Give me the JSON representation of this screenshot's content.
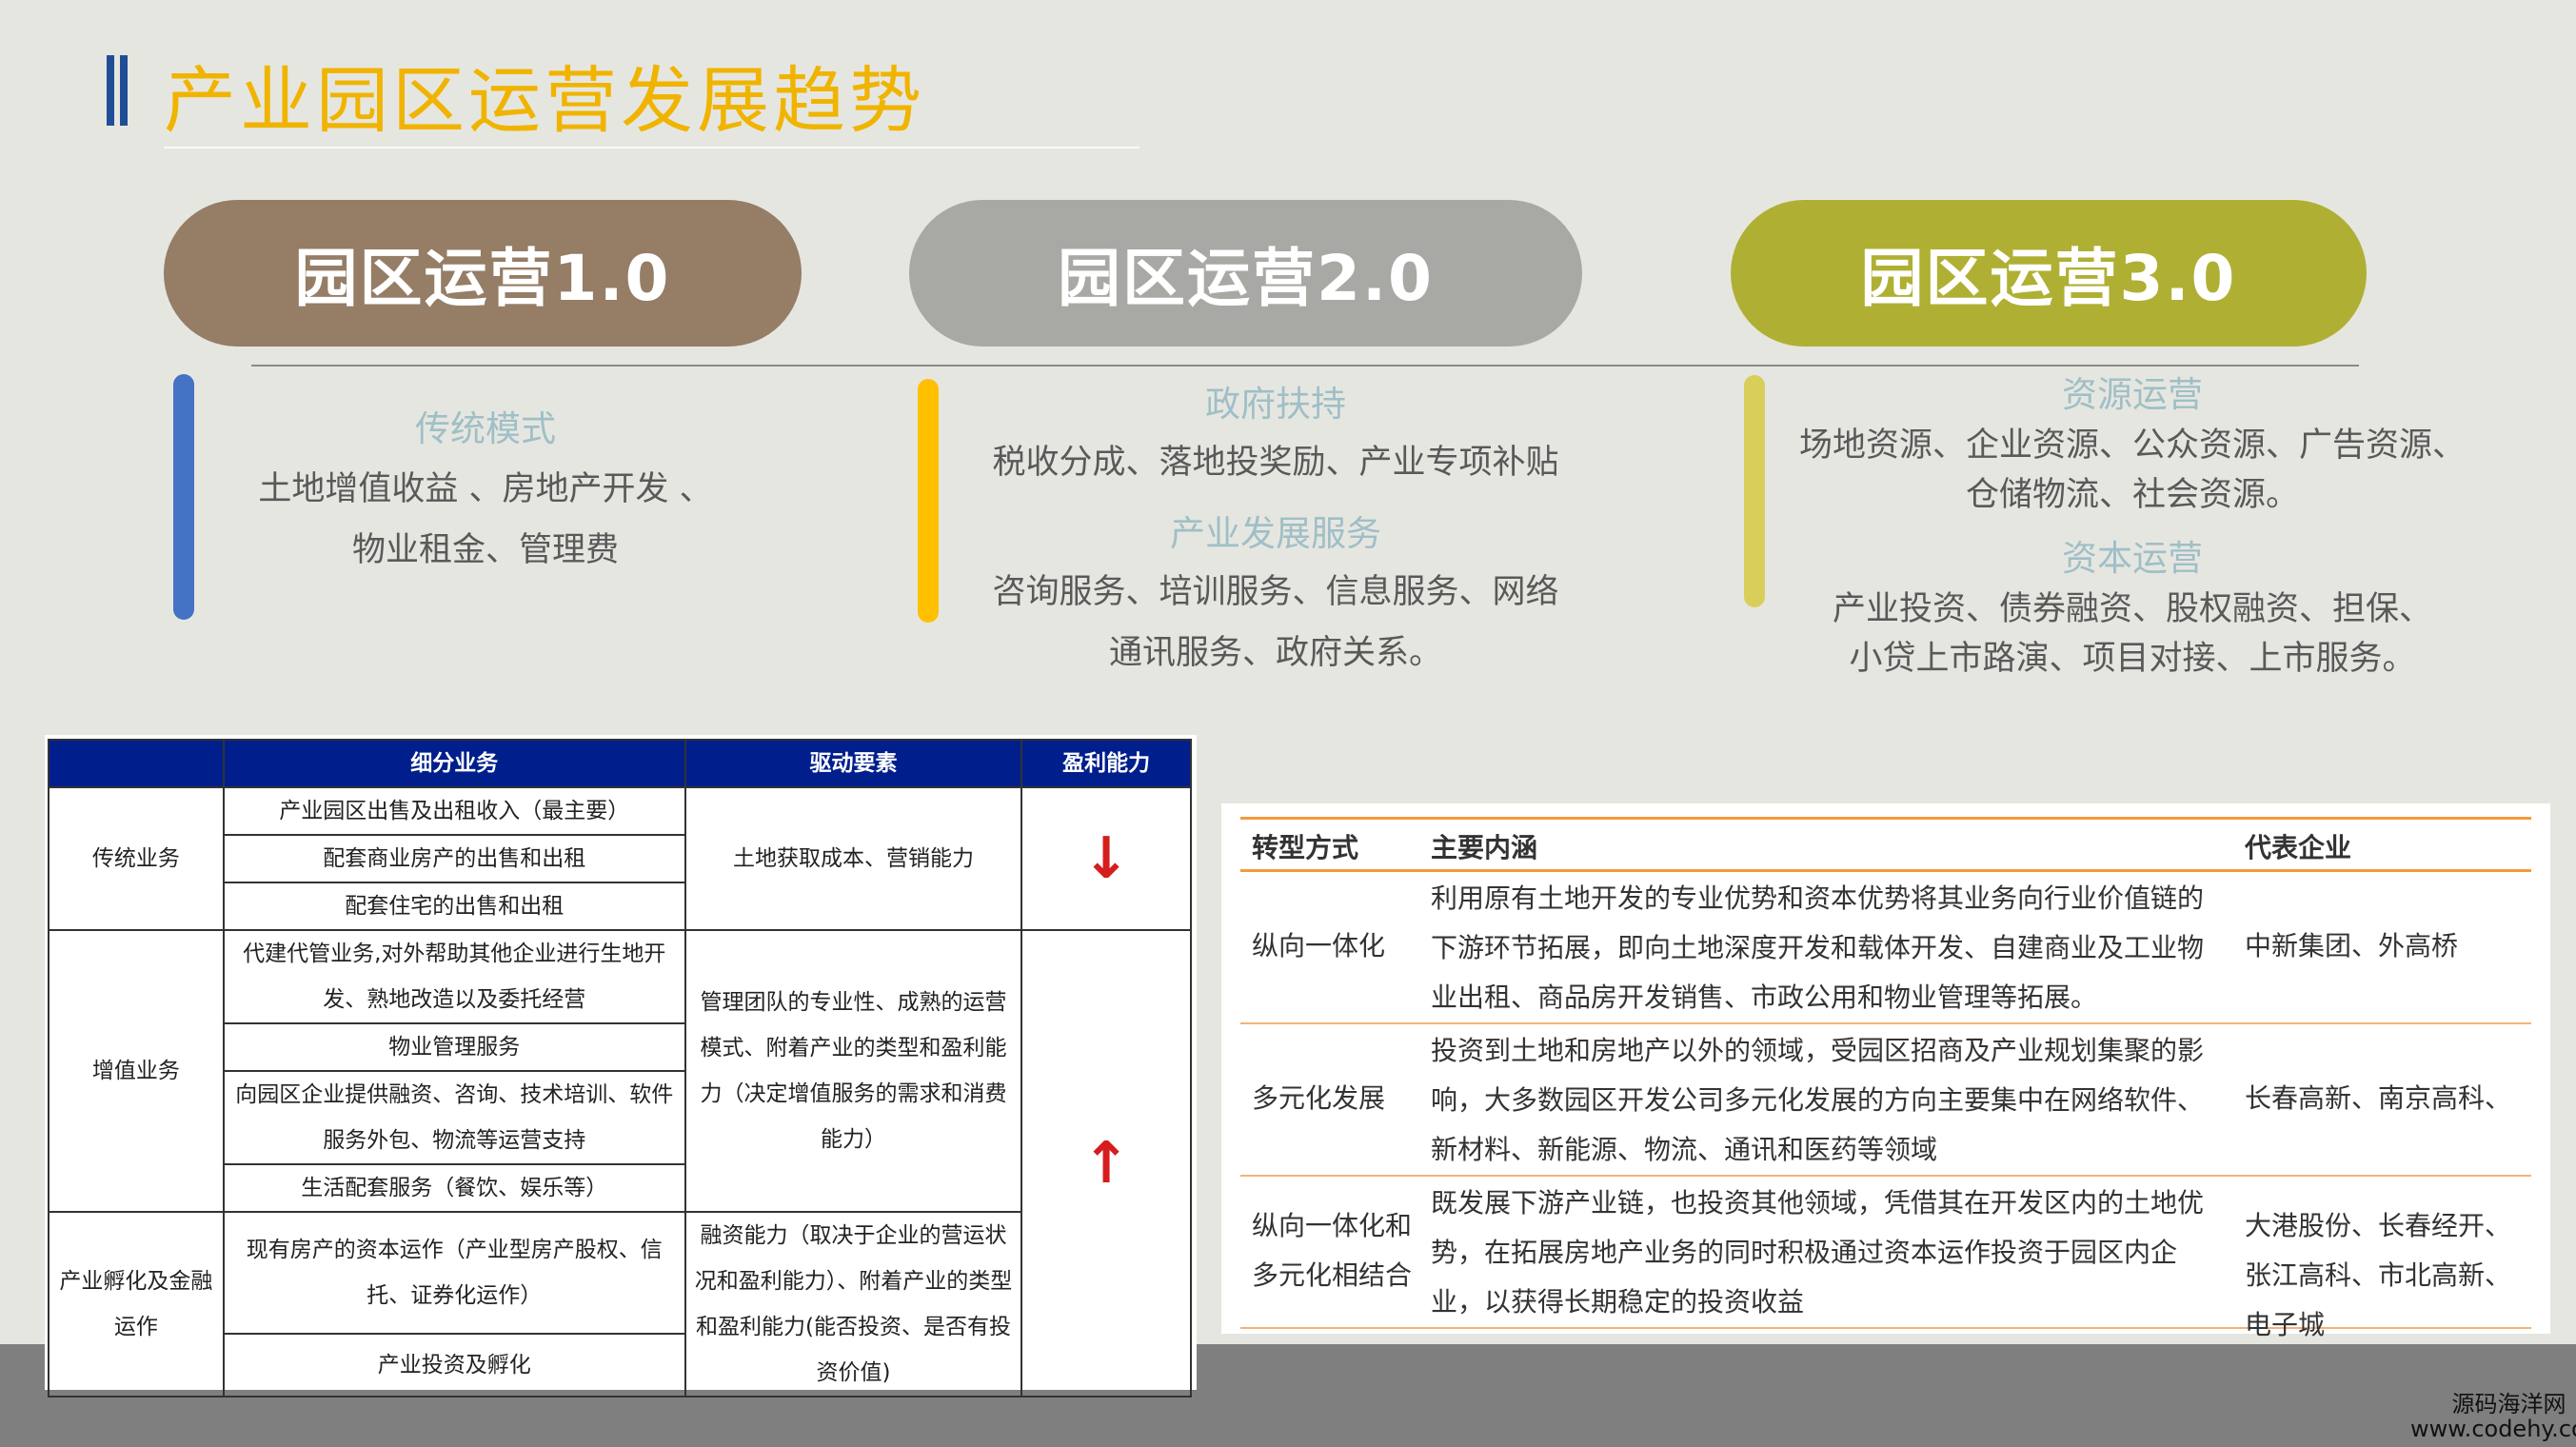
{
  "title": "产业园区运营发展趋势",
  "pills": [
    "园区运营1.0",
    "园区运营2.0",
    "园区运营3.0"
  ],
  "col1": {
    "subhead": "传统模式",
    "lines": [
      "土地增值收益 、房地产开发 、",
      "物业租金、管理费"
    ]
  },
  "col2": {
    "subhead1": "政府扶持",
    "line1": "税收分成、落地投奖励、产业专项补贴",
    "subhead2": "产业发展服务",
    "lines2": [
      "咨询服务、培训服务、信息服务、网络",
      "通讯服务、政府关系。"
    ]
  },
  "col3": {
    "subhead1": "资源运营",
    "lines1": [
      "场地资源、企业资源、公众资源、广告资源、",
      "仓储物流、社会资源。"
    ],
    "subhead2": "资本运营",
    "lines2": [
      "产业投资、债券融资、股权融资、担保、",
      "小贷上市路演、项目对接、上市服务。"
    ]
  },
  "table1": {
    "headers": [
      "细分业务",
      "驱动要素",
      "盈利能力"
    ],
    "g1": {
      "name": "传统业务",
      "items": [
        "产业园区出售及出租收入（最主要）",
        "配套商业房产的出售和出租",
        "配套住宅的出售和出租"
      ],
      "driver": "土地获取成本、营销能力",
      "arrow": "↓"
    },
    "g2": {
      "name": "增值业务",
      "items": [
        "代建代管业务,对外帮助其他企业进行生地开发、熟地改造以及委托经营",
        "物业管理服务",
        "向园区企业提供融资、咨询、技术培训、软件服务外包、物流等运营支持",
        "生活配套服务（餐饮、娱乐等）"
      ],
      "driver": "管理团队的专业性、成熟的运营模式、附着产业的类型和盈利能力（决定增值服务的需求和消费能力）",
      "arrow": "↑"
    },
    "g3": {
      "name": "产业孵化及金融运作",
      "items": [
        "现有房产的资本运作（产业型房产股权、信托、证券化运作）",
        "产业投资及孵化"
      ],
      "driver": "融资能力（取决于企业的营运状况和盈利能力）、附着产业的类型和盈利能力(能否投资、是否有投资价值)"
    }
  },
  "table2": {
    "headers": [
      "转型方式",
      "主要内涵",
      "代表企业"
    ],
    "rows": [
      {
        "type": "纵向一体化",
        "desc": "利用原有土地开发的专业优势和资本优势将其业务向行业价值链的下游环节拓展，即向土地深度开发和载体开发、自建商业及工业物业出租、商品房开发销售、市政公用和物业管理等拓展。",
        "corp": "中新集团、外高桥"
      },
      {
        "type": "多元化发展",
        "desc": "投资到土地和房地产以外的领域，受园区招商及产业规划集聚的影响，大多数园区开发公司多元化发展的方向主要集中在网络软件、新材料、新能源、物流、通讯和医药等领域",
        "corp": "长春高新、南京高科、"
      },
      {
        "type": "纵向一体化和多元化相结合",
        "desc": "既发展下游产业链，也投资其他领域，凭借其在开发区内的土地优势，在拓展房地产业务的同时积极通过资本运作投资于园区内企业，以获得长期稳定的投资收益",
        "corp": "大港股份、长春经开、张江高科、市北高新、电子城"
      }
    ]
  },
  "logo": {
    "line1": "源码海洋网",
    "line2": "www.codehy.com"
  },
  "colors": {
    "title": "#f0b400",
    "pill1": "#957d66",
    "pill2": "#a8a8a5",
    "pill3": "#afb033",
    "table_header": "#001f8c",
    "arrow": "#d61d1d"
  }
}
